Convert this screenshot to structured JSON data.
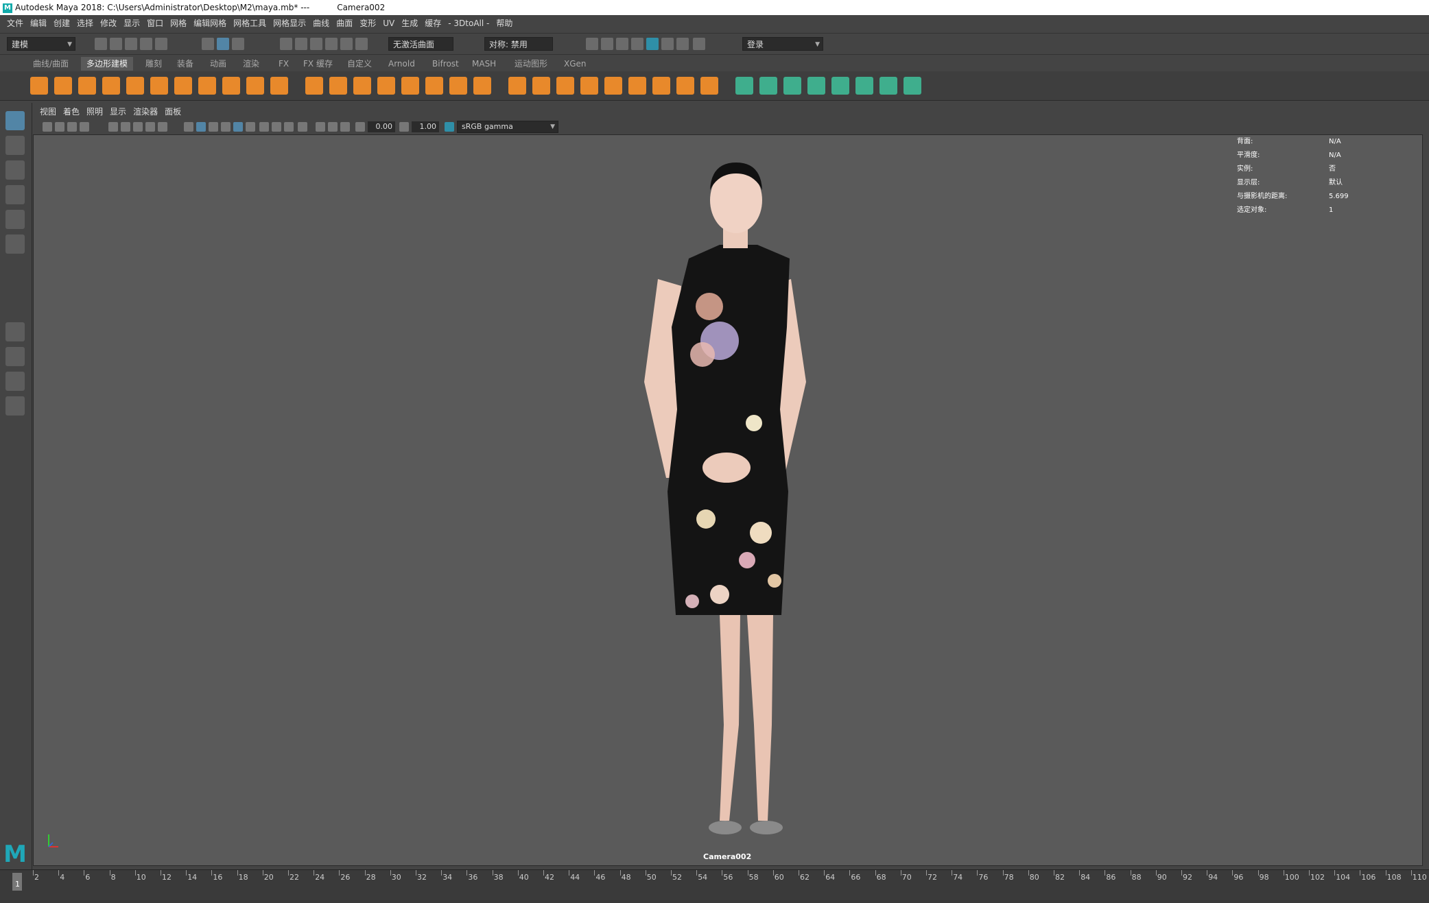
{
  "window": {
    "title": "Autodesk Maya 2018: C:\\Users\\Administrator\\Desktop\\M2\\maya.mb*   ---",
    "camera": "Camera002",
    "logo": "M"
  },
  "menubar": [
    "文件",
    "编辑",
    "创建",
    "选择",
    "修改",
    "显示",
    "窗口",
    "网格",
    "编辑网格",
    "网格工具",
    "网格显示",
    "曲线",
    "曲面",
    "变形",
    "UV",
    "生成",
    "缓存",
    "- 3DtoAll -",
    "帮助"
  ],
  "statusline": {
    "mode": "建模",
    "live_surface": "无激活曲面",
    "symmetry": "对称: 禁用",
    "login": "登录"
  },
  "shelf_tabs": [
    "曲线/曲面",
    "多边形建模",
    "雕刻",
    "装备",
    "动画",
    "渲染",
    "FX",
    "FX 缓存",
    "自定义",
    "Arnold",
    "Bifrost",
    "MASH",
    "运动图形",
    "XGen"
  ],
  "active_shelf_tab": 1,
  "panel_menu": [
    "视图",
    "着色",
    "照明",
    "显示",
    "渲染器",
    "面板"
  ],
  "panel_toolbar": {
    "exposure": "0.00",
    "gamma": "1.00",
    "color_space": "sRGB gamma"
  },
  "hud": [
    {
      "key": "背面:",
      "value": "N/A"
    },
    {
      "key": "平滑度:",
      "value": "N/A"
    },
    {
      "key": "实例:",
      "value": "否"
    },
    {
      "key": "显示层:",
      "value": "默认"
    },
    {
      "key": "与摄影机的距离:",
      "value": "5.699"
    },
    {
      "key": "选定对象:",
      "value": "1"
    }
  ],
  "viewport_camera_label": "Camera002",
  "timeline": {
    "current_frame": "1",
    "labels": [
      "2",
      "4",
      "6",
      "8",
      "10",
      "12",
      "14",
      "16",
      "18",
      "20",
      "22",
      "24",
      "26",
      "28",
      "30",
      "32",
      "34",
      "36",
      "38",
      "40",
      "42",
      "44",
      "46",
      "48",
      "50",
      "52",
      "54",
      "56",
      "58",
      "60",
      "62",
      "64",
      "66",
      "68",
      "70",
      "72",
      "74",
      "76",
      "78",
      "80",
      "82",
      "84",
      "86",
      "88",
      "90",
      "92",
      "94",
      "96",
      "98",
      "100",
      "102",
      "104",
      "106",
      "108",
      "110"
    ]
  },
  "colors": {
    "shelf_orange": "#e8892b",
    "shelf_green": "#3fae8d",
    "viewport_bg": "#5a5a5a",
    "accent_blue": "#5285a6"
  },
  "icons": {
    "select_tool": "arrow-select-icon",
    "maya_logo": "maya-logo-icon"
  }
}
